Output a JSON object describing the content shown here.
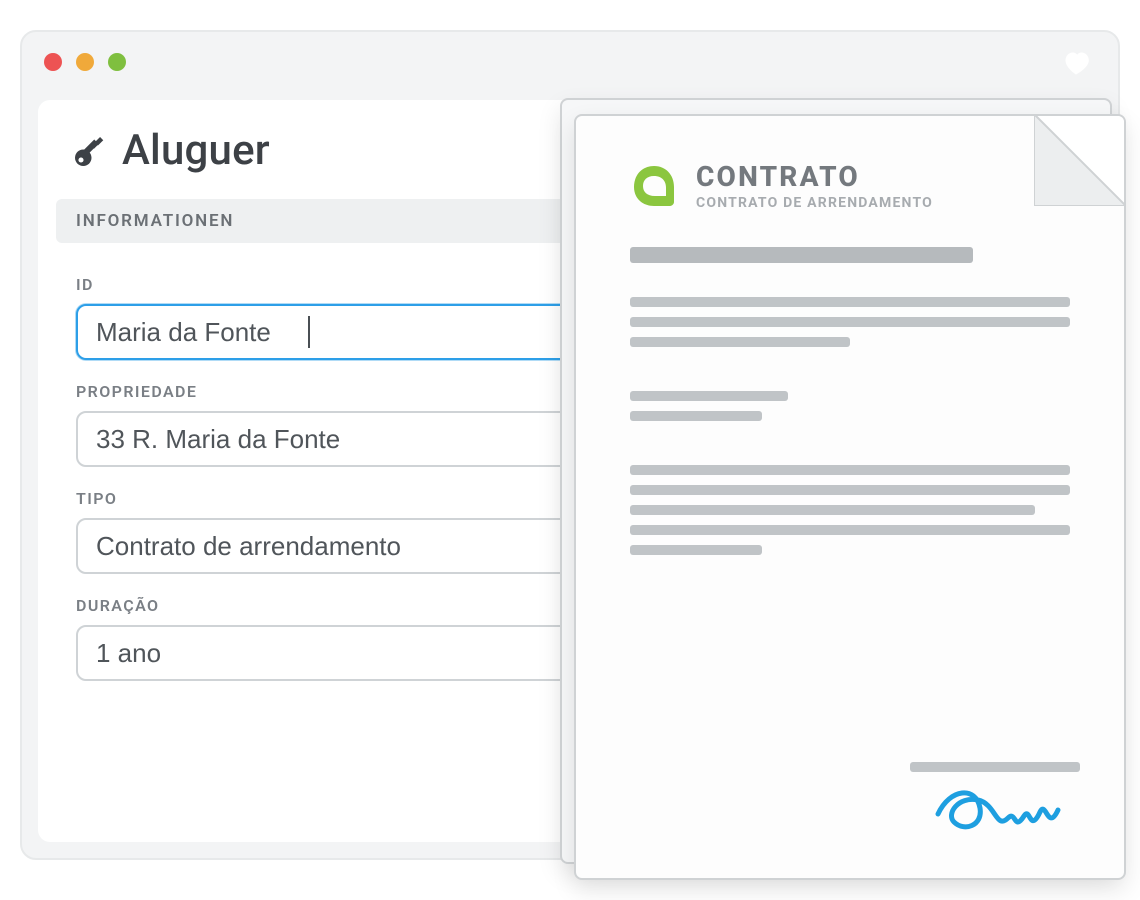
{
  "page": {
    "title": "Aluguer",
    "icon": "key-icon"
  },
  "section": {
    "header": "INFORMATIONEN"
  },
  "form": {
    "id": {
      "label": "ID",
      "value": "Maria da Fonte"
    },
    "property": {
      "label": "PROPRIEDADE",
      "value": "33 R. Maria da Fonte"
    },
    "type": {
      "label": "TIPO",
      "value": "Contrato de arrendamento"
    },
    "duration": {
      "label": "DURAÇÃO",
      "value": "1 ano"
    }
  },
  "document": {
    "title": "CONTRATO",
    "subtitle": "CONTRATO DE ARRENDAMENTO",
    "brand_color": "#8bc63f",
    "signature_color": "#1e9fe0"
  },
  "traffic_lights": {
    "red": "#ed5353",
    "yellow": "#f0a93a",
    "green": "#7fbf3f"
  }
}
